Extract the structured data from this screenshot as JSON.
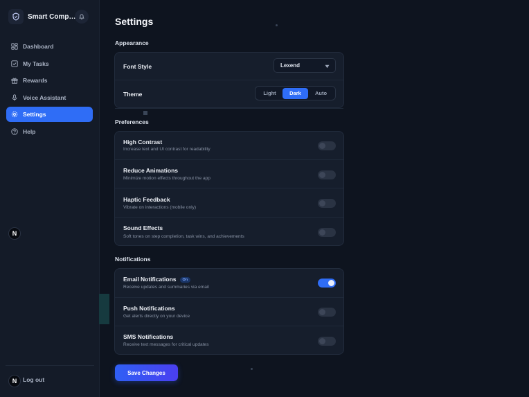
{
  "app": {
    "name": "Smart Compa..."
  },
  "sidebar": {
    "items": [
      {
        "label": "Dashboard",
        "icon": "dashboard-icon"
      },
      {
        "label": "My Tasks",
        "icon": "checkbox-icon"
      },
      {
        "label": "Rewards",
        "icon": "gift-icon"
      },
      {
        "label": "Voice Assistant",
        "icon": "microphone-icon"
      },
      {
        "label": "Settings",
        "icon": "gear-icon",
        "active": true
      },
      {
        "label": "Help",
        "icon": "help-icon"
      }
    ],
    "avatar_letter": "N",
    "logout_label": "Log out"
  },
  "page": {
    "title": "Settings"
  },
  "appearance": {
    "title": "Appearance",
    "font_style_label": "Font Style",
    "font_style_value": "Lexend",
    "theme_label": "Theme",
    "theme_options": [
      "Light",
      "Dark",
      "Auto"
    ],
    "theme_selected": "Dark"
  },
  "preferences": {
    "title": "Preferences",
    "items": [
      {
        "label": "High Contrast",
        "desc": "Increase text and UI contrast for readability",
        "on": false
      },
      {
        "label": "Reduce Animations",
        "desc": "Minimize motion effects throughout the app",
        "on": false
      },
      {
        "label": "Haptic Feedback",
        "desc": "Vibrate on interactions (mobile only)",
        "on": false
      },
      {
        "label": "Sound Effects",
        "desc": "Soft tones on step completion, task wins, and achievements",
        "on": false
      }
    ]
  },
  "notifications": {
    "title": "Notifications",
    "items": [
      {
        "label": "Email Notifications",
        "badge": "On",
        "desc": "Receive updates and summaries via email",
        "on": true
      },
      {
        "label": "Push Notifications",
        "desc": "Get alerts directly on your device",
        "on": false
      },
      {
        "label": "SMS Notifications",
        "desc": "Receive text messages for critical updates",
        "on": false
      }
    ]
  },
  "actions": {
    "save_label": "Save Changes"
  },
  "colors": {
    "accent": "#2f6df6",
    "background": "#0e141f",
    "sidebar": "#141b28",
    "card": "#161e2c"
  }
}
